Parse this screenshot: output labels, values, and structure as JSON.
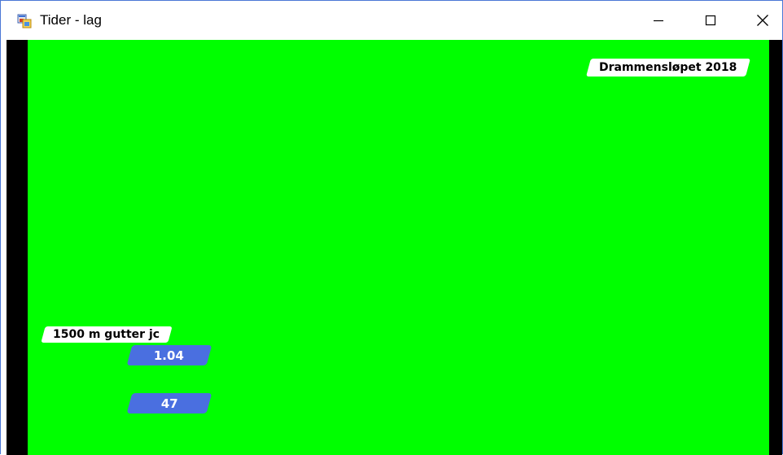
{
  "window": {
    "title": "Tider - lag",
    "icon": "windows-forms-app-icon",
    "controls": [
      "minimize-icon",
      "maximize-icon",
      "close-icon"
    ]
  },
  "display": {
    "background_color": "#00ff00",
    "side_color": "#000000",
    "event_name": "Drammensløpet 2018",
    "class_name": "1500 m gutter jc",
    "time_value": "1.04",
    "number_value": "47",
    "pill_color": "#4a6fe0"
  }
}
